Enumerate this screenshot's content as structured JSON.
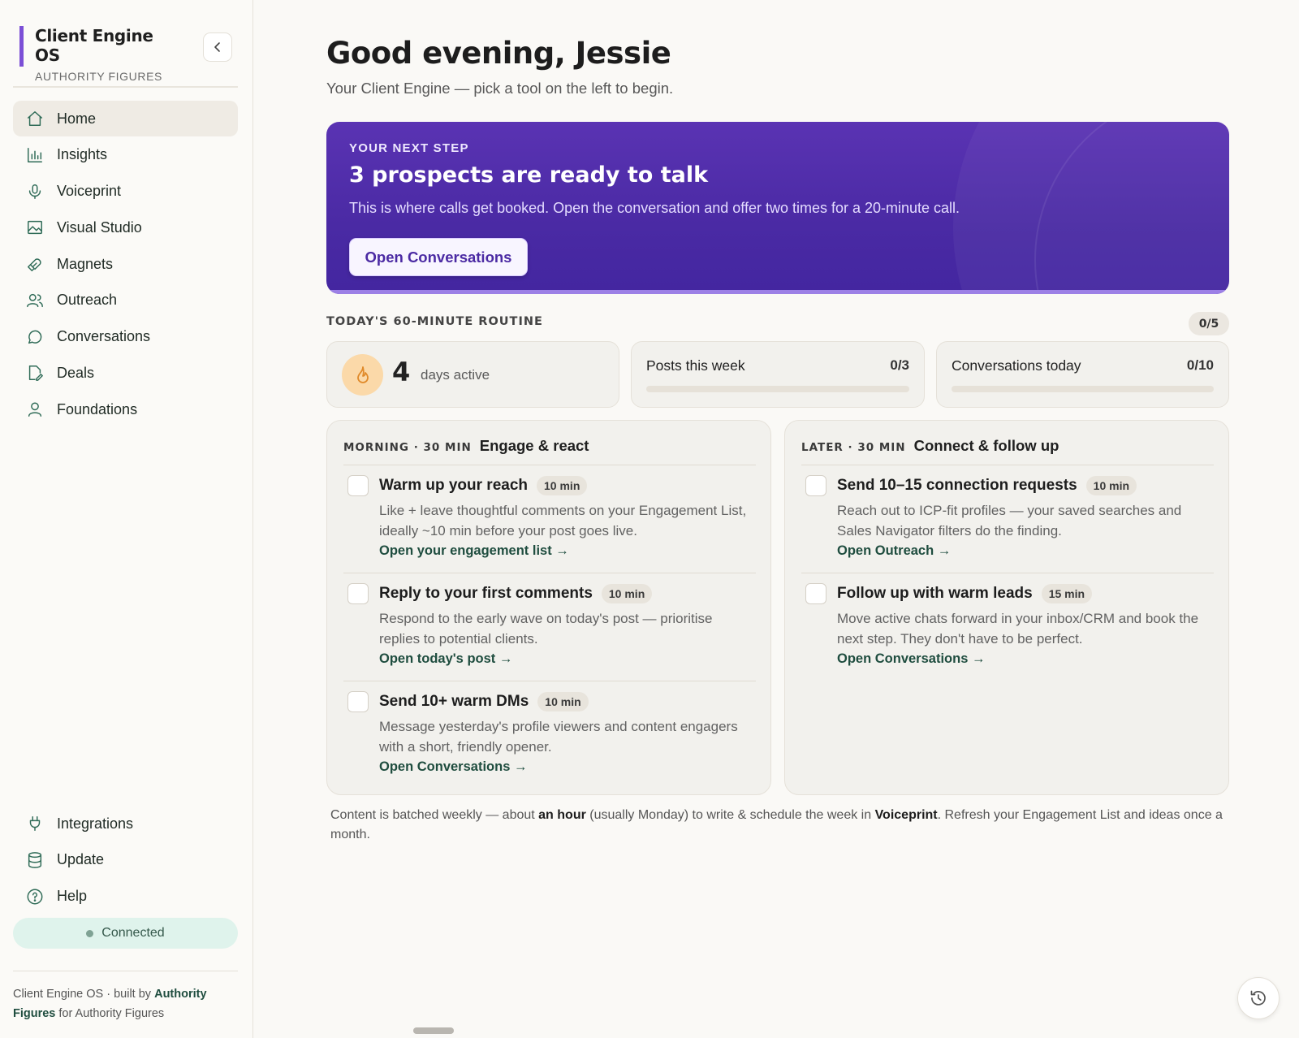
{
  "brand": {
    "title": "Client Engine OS",
    "subtitle": "AUTHORITY FIGURES",
    "accent": "#7b4fd6"
  },
  "sidebar": {
    "items": [
      {
        "label": "Home",
        "icon": "home-icon",
        "active": true
      },
      {
        "label": "Insights",
        "icon": "bar-chart-icon"
      },
      {
        "label": "Voiceprint",
        "icon": "microphone-icon"
      },
      {
        "label": "Visual Studio",
        "icon": "image-icon"
      },
      {
        "label": "Magnets",
        "icon": "magnet-icon"
      },
      {
        "label": "Outreach",
        "icon": "users-icon"
      },
      {
        "label": "Conversations",
        "icon": "chat-bubble-icon"
      },
      {
        "label": "Deals",
        "icon": "tag-icon"
      },
      {
        "label": "Foundations",
        "icon": "user-icon"
      }
    ],
    "bottom_items": [
      {
        "label": "Integrations",
        "icon": "plug-icon"
      },
      {
        "label": "Update",
        "icon": "database-icon"
      },
      {
        "label": "Help",
        "icon": "help-circle-icon"
      }
    ],
    "status": "Connected",
    "footer": {
      "prefix": "Client Engine OS · built by ",
      "author": "Authority Figures",
      "suffix": " for Authority Figures"
    }
  },
  "main": {
    "greeting": "Good evening, Jessie",
    "subtitle": "Your Client Engine — pick a tool on the left to begin.",
    "hero": {
      "eyebrow": "YOUR NEXT STEP",
      "title": "3 prospects are ready to talk",
      "body": "This is where calls get booked. Open the conversation and offer two times for a 20-minute call.",
      "button": "Open Conversations",
      "color": "#4f2eaa"
    },
    "routine": {
      "label": "TODAY'S 60-MINUTE ROUTINE",
      "count": "0/5",
      "streak": {
        "value": "4",
        "label": "days active"
      },
      "stats": [
        {
          "title": "Posts this week",
          "value": "0/3",
          "progress": 0
        },
        {
          "title": "Conversations today",
          "value": "0/10",
          "progress": 0
        }
      ]
    },
    "panels": [
      {
        "eyebrow": "MORNING · 30 MIN",
        "title": "Engage & react",
        "tasks": [
          {
            "title": "Warm up your reach",
            "time": "10 min",
            "desc": "Like + leave thoughtful comments on your Engagement List, ideally ~10 min before your post goes live.",
            "link": "Open your engagement list →"
          },
          {
            "title": "Reply to your first comments",
            "time": "10 min",
            "desc": "Respond to the early wave on today's post — prioritise replies to potential clients.",
            "link": "Open today's post →"
          },
          {
            "title": "Send 10+ warm DMs",
            "time": "10 min",
            "desc": "Message yesterday's profile viewers and content engagers with a short, friendly opener.",
            "link": "Open Conversations →"
          }
        ]
      },
      {
        "eyebrow": "LATER · 30 MIN",
        "title": "Connect & follow up",
        "tasks": [
          {
            "title": "Send 10–15 connection requests",
            "time": "10 min",
            "desc": "Reach out to ICP-fit profiles — your saved searches and Sales Navigator filters do the finding.",
            "link": "Open Outreach →"
          },
          {
            "title": "Follow up with warm leads",
            "time": "15 min",
            "desc": "Move active chats forward in your inbox/CRM and book the next step. They don't have to be perfect.",
            "link": "Open Conversations →"
          }
        ]
      }
    ],
    "batch_note": {
      "t1": "Content is batched weekly — about ",
      "b1": "an hour",
      "t2": " (usually Monday) to write & schedule the week in ",
      "b2": "Voiceprint",
      "t3": ". Refresh your Engagement List and ideas once a month."
    }
  }
}
